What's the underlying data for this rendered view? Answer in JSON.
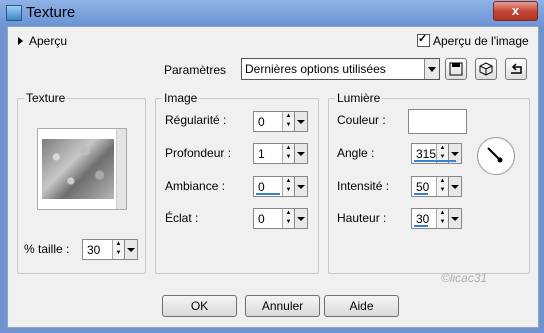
{
  "window": {
    "title": "Texture",
    "close_label": "x"
  },
  "preview": {
    "expander_label": "Aperçu",
    "checkbox_label": "Aperçu de l'image",
    "checked": true
  },
  "params": {
    "label": "Paramètres",
    "value": "Dernières options utilisées"
  },
  "texture": {
    "title": "Texture",
    "size_label": "% taille :",
    "size_value": "30"
  },
  "image": {
    "title": "Image",
    "fields": [
      {
        "label": "Régularité :",
        "value": "0"
      },
      {
        "label": "Profondeur :",
        "value": "1"
      },
      {
        "label": "Ambiance :",
        "value": "0"
      },
      {
        "label": "Éclat :",
        "value": "0"
      }
    ]
  },
  "light": {
    "title": "Lumière",
    "color_label": "Couleur :",
    "fields": [
      {
        "label": "Angle :",
        "value": "315"
      },
      {
        "label": "Intensité :",
        "value": "50"
      },
      {
        "label": "Hauteur :",
        "value": "30"
      }
    ]
  },
  "buttons": {
    "ok": "OK",
    "cancel": "Annuler",
    "help": "Aide"
  },
  "watermark": "©licac31"
}
